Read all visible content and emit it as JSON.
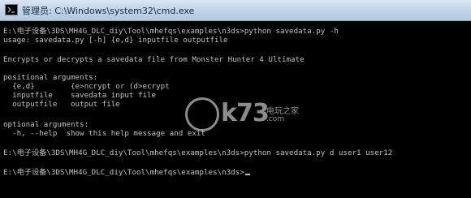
{
  "window": {
    "title": "管理员: C:\\Windows\\system32\\cmd.exe"
  },
  "console": {
    "lines": [
      "E:\\电子设备\\3DS\\MH4G_DLC_diy\\Tool\\mhefqs\\examples\\n3ds>python savedata.py -h",
      "usage: savedata.py [-h] {e,d} inputfile outputfile",
      "",
      "Encrypts or decrypts a savedata file from Monster Hunter 4 Ultimate",
      "",
      "positional arguments:",
      "  {e,d}        {e>ncrypt or (d>ecrypt",
      "  inputfile    savedata input file",
      "  outputfile   output file",
      "",
      "optional arguments:",
      "  -h, --help  show this help message and exit",
      "",
      "E:\\电子设备\\3DS\\MH4G_DLC_diy\\Tool\\mhefqs\\examples\\n3ds>python savedata.py d user1 user12",
      "",
      "E:\\电子设备\\3DS\\MH4G_DLC_diy\\Tool\\mhefqs\\examples\\n3ds>"
    ]
  },
  "watermark": {
    "brand": "k73",
    "cn": "电玩之家",
    "com": ".com"
  }
}
